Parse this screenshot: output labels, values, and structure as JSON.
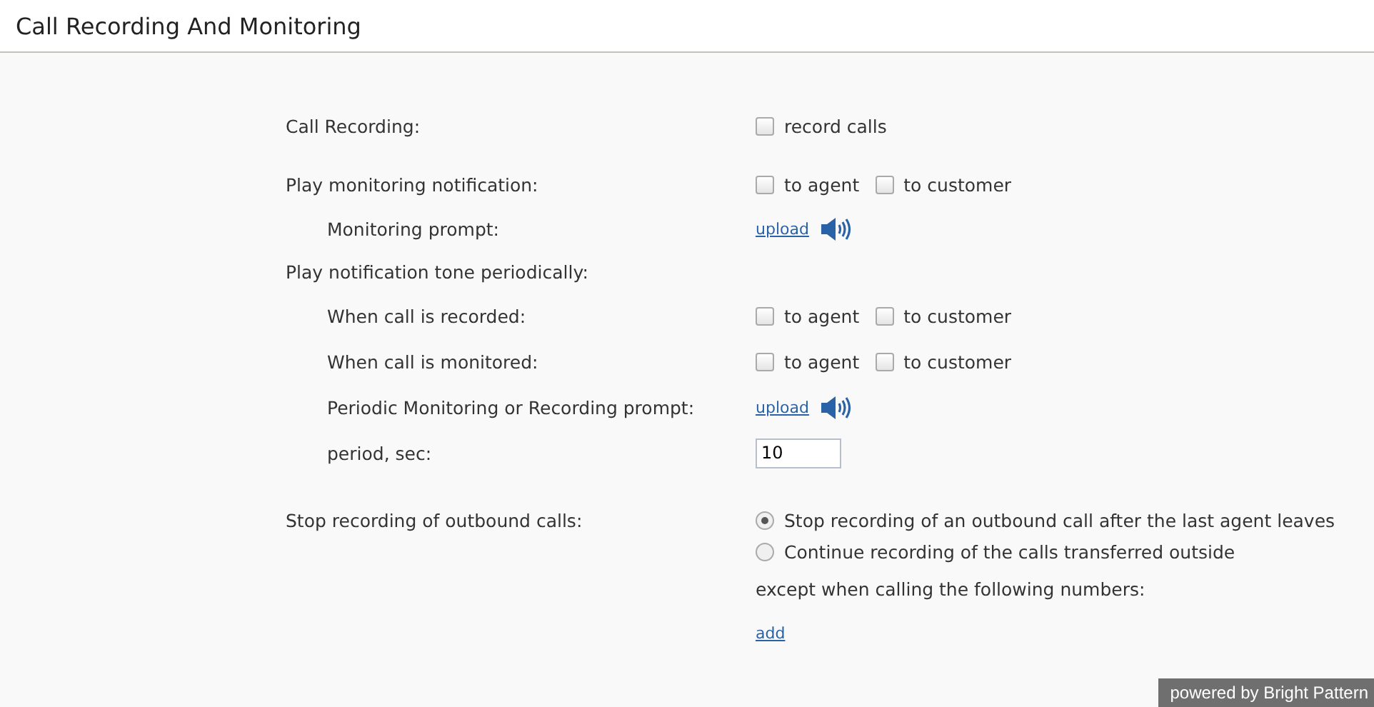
{
  "title": "Call Recording And Monitoring",
  "rows": [
    {
      "kind": "checks",
      "label": "Call Recording:",
      "indented": false,
      "options": [
        {
          "label": "record calls",
          "checked": false
        }
      ]
    },
    {
      "kind": "checks",
      "label": "Play monitoring notification:",
      "indented": false,
      "options": [
        {
          "label": "to agent",
          "checked": false
        },
        {
          "label": "to customer",
          "checked": false
        }
      ]
    },
    {
      "kind": "upload",
      "label": "Monitoring prompt:",
      "indented": true,
      "link": "upload"
    },
    {
      "kind": "heading",
      "label": "Play notification tone periodically:",
      "indented": false
    },
    {
      "kind": "checks",
      "label": "When call is recorded:",
      "indented": true,
      "options": [
        {
          "label": "to agent",
          "checked": false
        },
        {
          "label": "to customer",
          "checked": false
        }
      ]
    },
    {
      "kind": "checks",
      "label": "When call is monitored:",
      "indented": true,
      "options": [
        {
          "label": "to agent",
          "checked": false
        },
        {
          "label": "to customer",
          "checked": false
        }
      ]
    },
    {
      "kind": "upload",
      "label": "Periodic Monitoring or Recording prompt:",
      "indented": true,
      "link": "upload"
    },
    {
      "kind": "input",
      "label": "period, sec:",
      "indented": true,
      "value": "10"
    }
  ],
  "outbound": {
    "label": "Stop recording of outbound calls:",
    "radios": [
      {
        "label": "Stop recording of an outbound call after the last agent leaves",
        "selected": true
      },
      {
        "label": "Continue recording of the calls transferred outside",
        "selected": false
      }
    ],
    "note": "except when calling the following numbers:",
    "link": "add"
  },
  "footer": "powered by Bright Pattern"
}
